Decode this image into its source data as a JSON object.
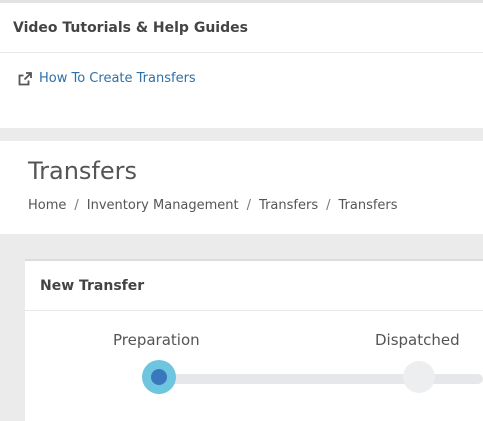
{
  "help": {
    "title": "Video Tutorials & Help Guides",
    "link_label": "How To Create Transfers",
    "link_icon": "external-link-icon"
  },
  "page": {
    "title": "Transfers",
    "breadcrumb": [
      "Home",
      "Inventory Management",
      "Transfers",
      "Transfers"
    ],
    "breadcrumb_separator": "/"
  },
  "new_transfer": {
    "title": "New Transfer",
    "steps": [
      {
        "label": "Preparation",
        "state": "active"
      },
      {
        "label": "Dispatched",
        "state": "pending"
      }
    ]
  },
  "colors": {
    "link": "#2f6fa8",
    "step_active_outer": "#6ec5df",
    "step_active_inner": "#3a78be",
    "step_inactive": "#eceef0",
    "track": "#e5e7ea"
  }
}
